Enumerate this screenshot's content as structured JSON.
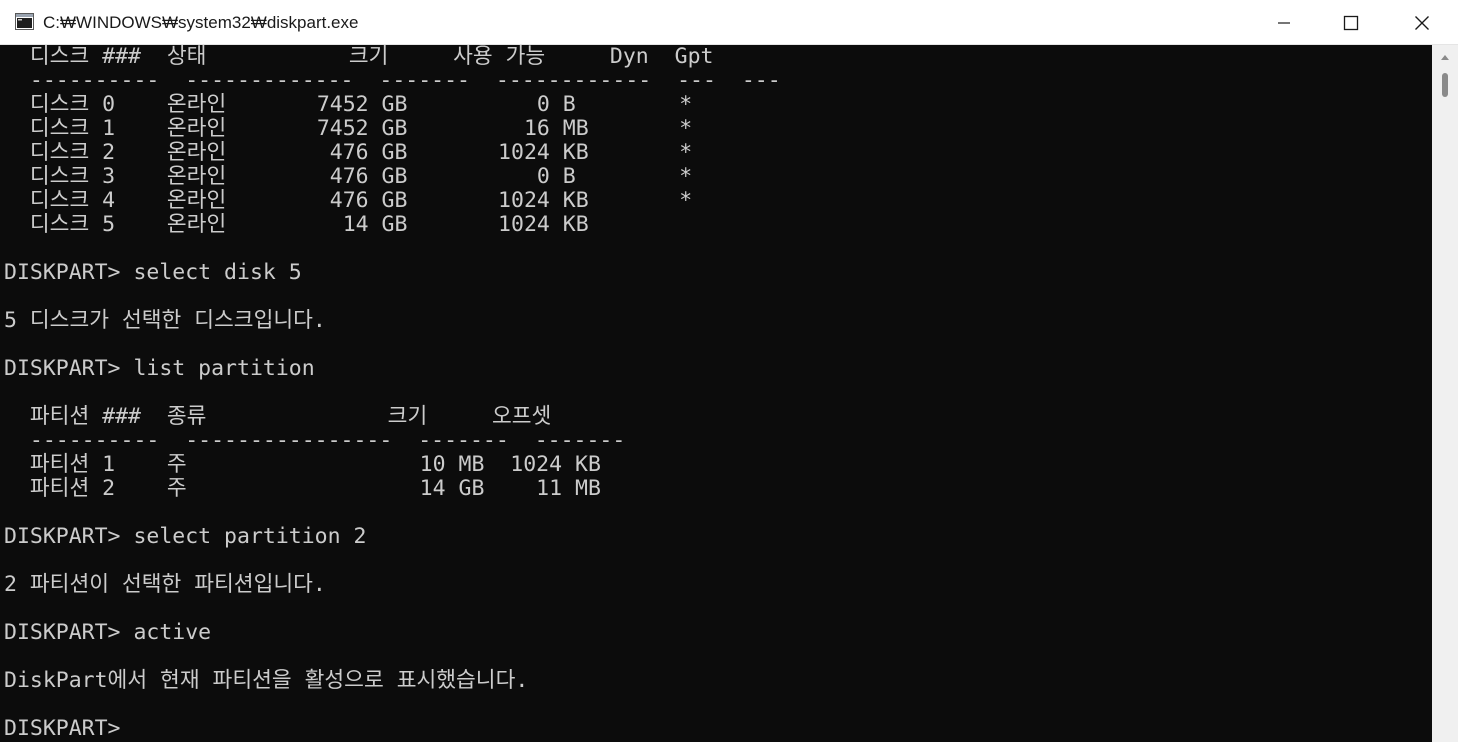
{
  "window": {
    "title": "C:₩WINDOWS₩system32₩diskpart.exe"
  },
  "icons": {
    "app": "console-app-icon",
    "minimize": "minimize-icon",
    "maximize": "maximize-icon",
    "close": "close-icon",
    "scroll_up": "scroll-up-arrow-icon"
  },
  "colors": {
    "console_bg": "#0c0c0c",
    "console_text": "#cccccc",
    "titlebar_bg": "#ffffff"
  },
  "console": {
    "lines": [
      "  디스크 ###  상태           크기     사용 가능     Dyn  Gpt",
      "  ----------  -------------  -------  ------------  ---  ---",
      "  디스크 0    온라인       7452 GB          0 B        *",
      "  디스크 1    온라인       7452 GB         16 MB       *",
      "  디스크 2    온라인        476 GB       1024 KB       *",
      "  디스크 3    온라인        476 GB          0 B        *",
      "  디스크 4    온라인        476 GB       1024 KB       *",
      "  디스크 5    온라인         14 GB       1024 KB",
      "",
      "DISKPART> select disk 5",
      "",
      "5 디스크가 선택한 디스크입니다.",
      "",
      "DISKPART> list partition",
      "",
      "  파티션 ###  종류              크기     오프셋",
      "  ----------  ----------------  -------  -------",
      "  파티션 1    주                  10 MB  1024 KB",
      "  파티션 2    주                  14 GB    11 MB",
      "",
      "DISKPART> select partition 2",
      "",
      "2 파티션이 선택한 파티션입니다.",
      "",
      "DISKPART> active",
      "",
      "DiskPart에서 현재 파티션을 활성으로 표시했습니다.",
      "",
      "DISKPART> "
    ]
  }
}
